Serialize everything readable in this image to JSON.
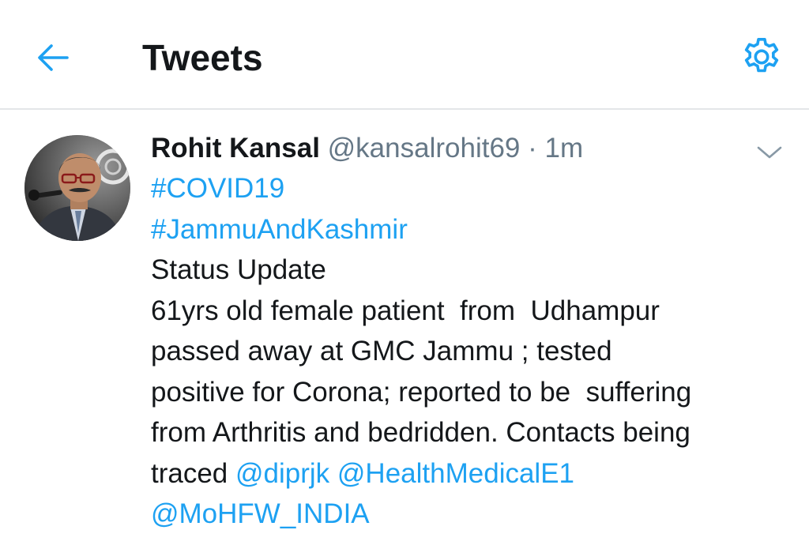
{
  "header": {
    "title": "Tweets",
    "back_icon": "arrow-left-icon",
    "settings_icon": "gear-icon"
  },
  "colors": {
    "accent": "#1da1f2",
    "text": "#14171a",
    "secondary": "#657786",
    "divider": "#e3e6e8"
  },
  "tweet": {
    "author_name": "Rohit Kansal",
    "author_handle": "@kansalrohit69",
    "separator": "·",
    "time": "1m",
    "menu_icon": "chevron-down-icon",
    "hashtags": [
      "#COVID19",
      "#JammuAndKashmir"
    ],
    "status_line": "Status Update",
    "body_lines": [
      "61yrs old female patient  from  Udhampur",
      "passed away at GMC Jammu ; tested",
      "positive for Corona; reported to be  suffering",
      "from Arthritis and bedridden. Contacts being"
    ],
    "traced_text": "traced ",
    "mentions": [
      "@diprjk",
      "@HealthMedicalE1",
      "@MoHFW_INDIA"
    ]
  }
}
